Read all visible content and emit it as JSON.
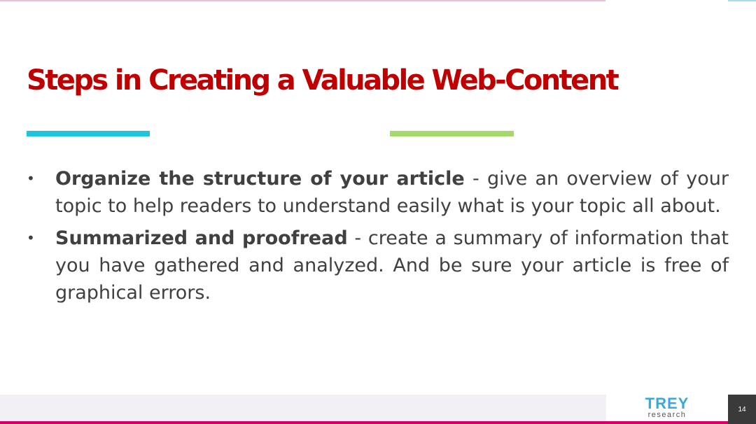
{
  "slide": {
    "title": "Steps in Creating a Valuable Web-Content",
    "colors": {
      "title": "#c00000",
      "accent_blue": "#1cc5e0",
      "accent_green": "#a6d96a",
      "footer_line": "#d0006f"
    },
    "bullets": [
      {
        "term": "Organize the structure of your article",
        "text": " - give an overview of your topic to help readers to understand easily what is your topic all about."
      },
      {
        "term": "Summarized and proofread",
        "text": " - create a summary of information that you have gathered and analyzed. And be sure your article is free of graphical errors."
      }
    ]
  },
  "footer": {
    "logo_main": "TREY",
    "logo_sub": "research",
    "page_number": "14"
  }
}
